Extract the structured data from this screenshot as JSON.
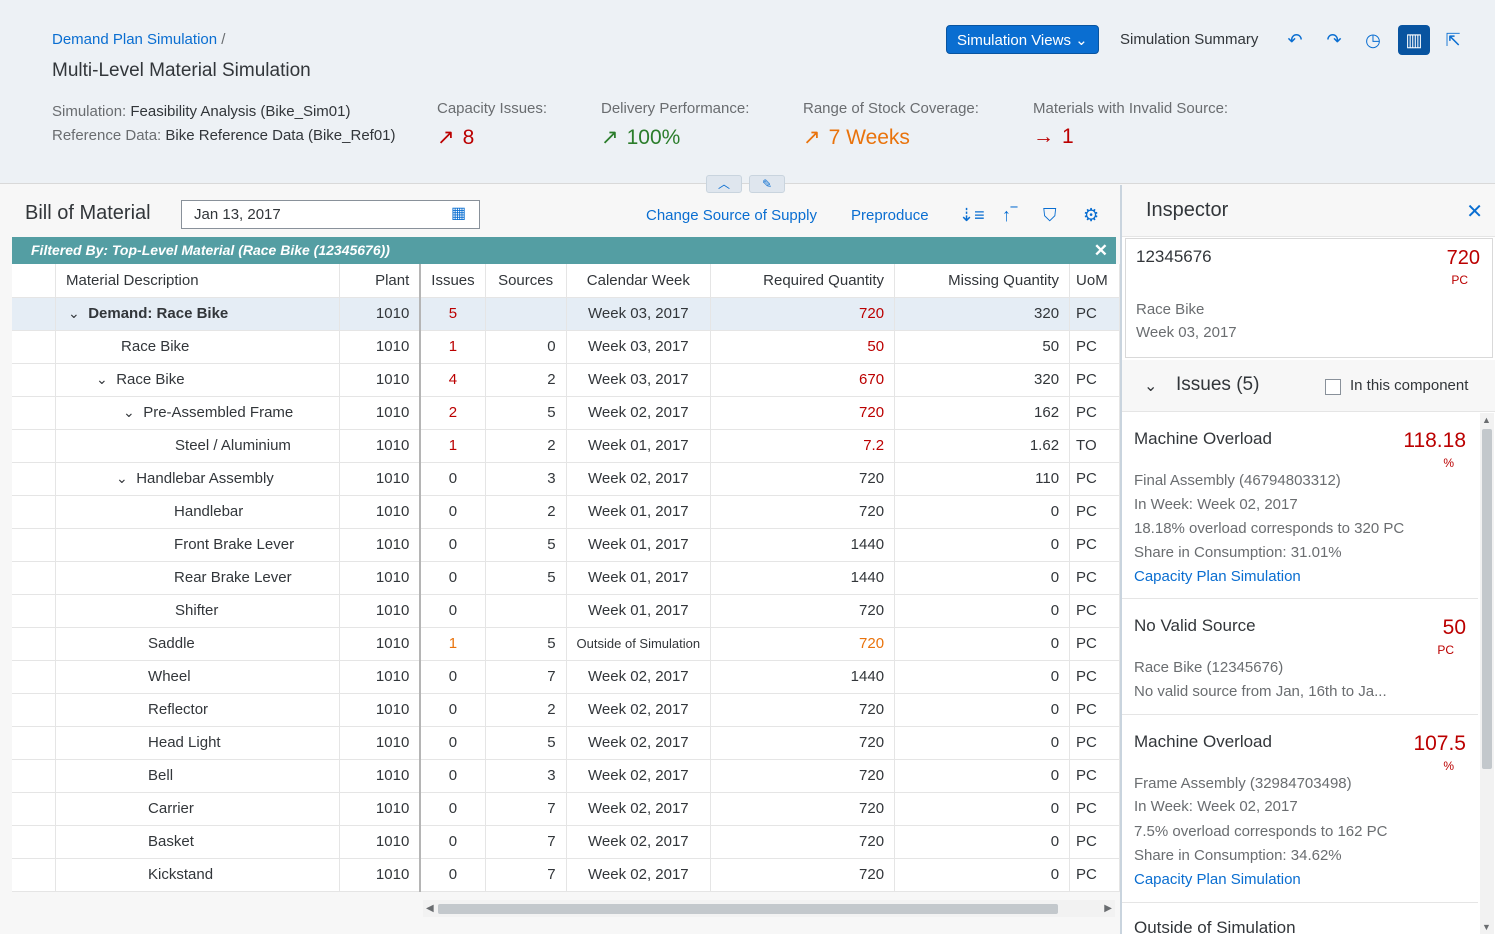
{
  "header": {
    "breadcrumb": "Demand Plan Simulation",
    "breadcrumb_sep": "/",
    "title": "Multi-Level Material Simulation",
    "simulation_label": "Simulation:",
    "simulation_value": "Feasibility Analysis (Bike_Sim01)",
    "reference_label": "Reference Data:",
    "reference_value": "Bike Reference Data (Bike_Ref01)",
    "kpis": [
      {
        "label": "Capacity Issues:",
        "value": "8",
        "arrow": "↗"
      },
      {
        "label": "Delivery Performance:",
        "value": "100%",
        "arrow": "↗"
      },
      {
        "label": "Range of Stock Coverage:",
        "value": "7 Weeks",
        "arrow": "↗"
      },
      {
        "label": "Materials with Invalid Source:",
        "value": "1",
        "arrow": "→"
      }
    ],
    "simulation_views": "Simulation Views",
    "simulation_summary": "Simulation Summary"
  },
  "bom": {
    "title": "Bill of Material",
    "date": "Jan 13, 2017",
    "change_source": "Change Source of Supply",
    "preproduce": "Preproduce",
    "filter_text": "Filtered By: Top-Level Material (Race Bike (12345676))",
    "columns": [
      "Material Description",
      "Plant",
      "Issues",
      "Sources",
      "Calendar Week",
      "Required Quantity",
      "Missing Quantity",
      "UoM"
    ],
    "rows": [
      {
        "desc": "Demand: Race Bike",
        "plant": "1010",
        "issues": "5",
        "sources": "",
        "week": "Week 03, 2017",
        "req": "720",
        "miss": "320",
        "uom": "PC"
      },
      {
        "desc": "Race Bike",
        "plant": "1010",
        "issues": "1",
        "sources": "0",
        "week": "Week 03, 2017",
        "req": "50",
        "miss": "50",
        "uom": "PC"
      },
      {
        "desc": "Race Bike",
        "plant": "1010",
        "issues": "4",
        "sources": "2",
        "week": "Week 03, 2017",
        "req": "670",
        "miss": "320",
        "uom": "PC"
      },
      {
        "desc": "Pre-Assembled Frame",
        "plant": "1010",
        "issues": "2",
        "sources": "5",
        "week": "Week 02, 2017",
        "req": "720",
        "miss": "162",
        "uom": "PC"
      },
      {
        "desc": "Steel / Aluminium",
        "plant": "1010",
        "issues": "1",
        "sources": "2",
        "week": "Week 01, 2017",
        "req": "7.2",
        "miss": "1.62",
        "uom": "TO"
      },
      {
        "desc": "Handlebar Assembly",
        "plant": "1010",
        "issues": "0",
        "sources": "3",
        "week": "Week 02, 2017",
        "req": "720",
        "miss": "110",
        "uom": "PC"
      },
      {
        "desc": "Handlebar",
        "plant": "1010",
        "issues": "0",
        "sources": "2",
        "week": "Week 01, 2017",
        "req": "720",
        "miss": "0",
        "uom": "PC"
      },
      {
        "desc": "Front Brake Lever",
        "plant": "1010",
        "issues": "0",
        "sources": "5",
        "week": "Week 01, 2017",
        "req": "1440",
        "miss": "0",
        "uom": "PC"
      },
      {
        "desc": "Rear Brake Lever",
        "plant": "1010",
        "issues": "0",
        "sources": "5",
        "week": "Week 01, 2017",
        "req": "1440",
        "miss": "0",
        "uom": "PC"
      },
      {
        "desc": "Shifter",
        "plant": "1010",
        "issues": "0",
        "sources": "",
        "week": "Week 01, 2017",
        "req": "720",
        "miss": "0",
        "uom": "PC"
      },
      {
        "desc": "Saddle",
        "plant": "1010",
        "issues": "1",
        "sources": "5",
        "week": "Outside of Simulation",
        "req": "720",
        "miss": "0",
        "uom": "PC"
      },
      {
        "desc": "Wheel",
        "plant": "1010",
        "issues": "0",
        "sources": "7",
        "week": "Week 02, 2017",
        "req": "1440",
        "miss": "0",
        "uom": "PC"
      },
      {
        "desc": "Reflector",
        "plant": "1010",
        "issues": "0",
        "sources": "2",
        "week": "Week 02, 2017",
        "req": "720",
        "miss": "0",
        "uom": "PC"
      },
      {
        "desc": "Head Light",
        "plant": "1010",
        "issues": "0",
        "sources": "5",
        "week": "Week 02, 2017",
        "req": "720",
        "miss": "0",
        "uom": "PC"
      },
      {
        "desc": "Bell",
        "plant": "1010",
        "issues": "0",
        "sources": "3",
        "week": "Week 02, 2017",
        "req": "720",
        "miss": "0",
        "uom": "PC"
      },
      {
        "desc": "Carrier",
        "plant": "1010",
        "issues": "0",
        "sources": "7",
        "week": "Week 02, 2017",
        "req": "720",
        "miss": "0",
        "uom": "PC"
      },
      {
        "desc": "Basket",
        "plant": "1010",
        "issues": "0",
        "sources": "7",
        "week": "Week 02, 2017",
        "req": "720",
        "miss": "0",
        "uom": "PC"
      },
      {
        "desc": "Kickstand",
        "plant": "1010",
        "issues": "0",
        "sources": "7",
        "week": "Week 02, 2017",
        "req": "720",
        "miss": "0",
        "uom": "PC"
      }
    ]
  },
  "inspector": {
    "title": "Inspector",
    "card": {
      "id": "12345676",
      "qty": "720",
      "unit": "PC",
      "line1": "Race Bike",
      "line2": "Week 03, 2017"
    },
    "issues_title": "Issues (5)",
    "in_component": "In this component",
    "issues": [
      {
        "title": "Machine Overload",
        "value": "118.18",
        "unit": "%",
        "lines": [
          "Final Assembly (46794803312)",
          "In Week: Week 02, 2017",
          "18.18% overload corresponds to 320 PC",
          "Share in Consumption: 31.01%"
        ],
        "link": "Capacity Plan Simulation"
      },
      {
        "title": "No Valid Source",
        "value": "50",
        "unit": "PC",
        "lines": [
          "Race Bike (12345676)",
          "No valid source from Jan, 16th to Ja..."
        ],
        "link": ""
      },
      {
        "title": "Machine Overload",
        "value": "107.5",
        "unit": "%",
        "lines": [
          "Frame Assembly (32984703498)",
          "In Week: Week 02, 2017",
          "7.5% overload corresponds to 162 PC",
          "Share in Consumption: 34.62%"
        ],
        "link": "Capacity Plan Simulation"
      }
    ],
    "partial_next": "Outside of Simulation"
  }
}
